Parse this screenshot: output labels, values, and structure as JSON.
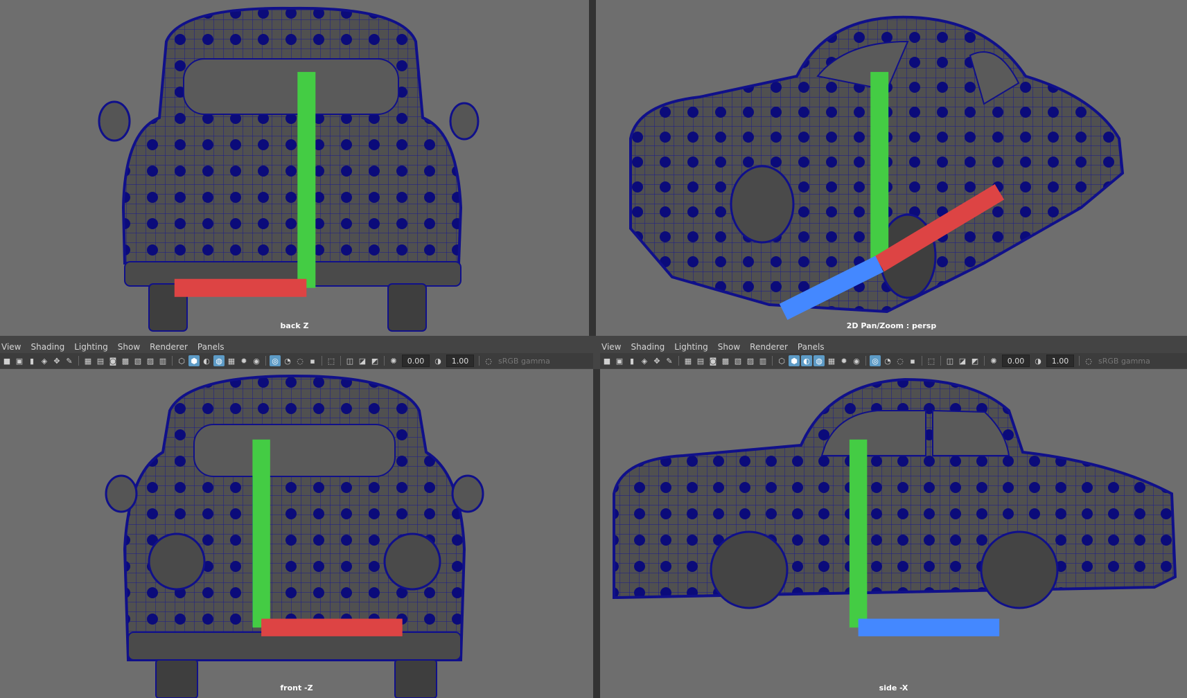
{
  "viewports": {
    "top_left": {
      "camera_label": "back Z"
    },
    "top_right": {
      "camera_label": "2D Pan/Zoom : persp"
    },
    "bottom_left": {
      "camera_label": "front -Z"
    },
    "bottom_right": {
      "camera_label": "side -X"
    }
  },
  "menu": {
    "view": "View",
    "shading": "Shading",
    "lighting": "Lighting",
    "show": "Show",
    "renderer": "Renderer",
    "panels": "Panels"
  },
  "toolbar": {
    "exposure": "0.00",
    "gamma": "1.00",
    "colorspace": "sRGB gamma"
  },
  "axis": {
    "x": "x",
    "y": "y",
    "z": "z"
  },
  "colors": {
    "viewport_bg": "#6e6e6e",
    "wire": "#10108a",
    "dot": "#0b0b7a",
    "active_icon": "#5d9bc6"
  }
}
